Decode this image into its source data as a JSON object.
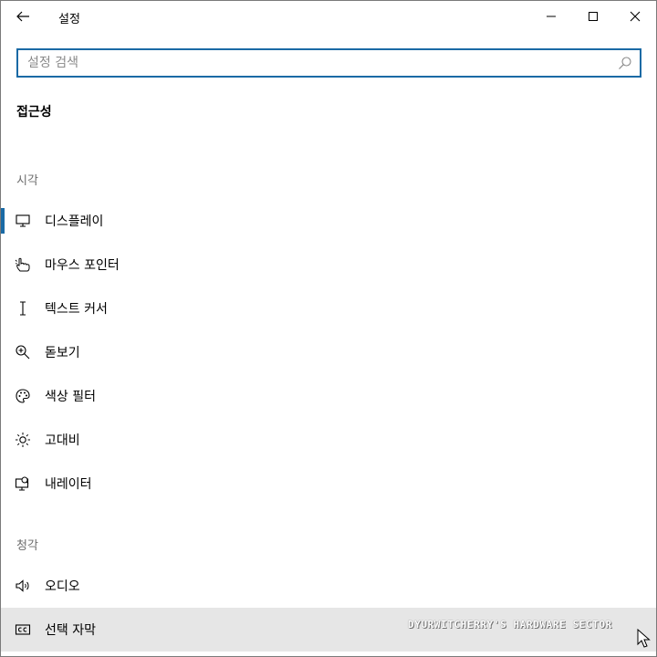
{
  "window": {
    "title": "설정"
  },
  "search": {
    "placeholder": "설정 검색",
    "value": ""
  },
  "page": {
    "title": "접근성"
  },
  "groups": {
    "vision": "시각",
    "hearing": "청각"
  },
  "items": [
    {
      "label": "디스플레이",
      "icon": "monitor-icon",
      "selected": true
    },
    {
      "label": "마우스 포인터",
      "icon": "mouse-pointer-icon"
    },
    {
      "label": "텍스트 커서",
      "icon": "text-cursor-icon"
    },
    {
      "label": "돋보기",
      "icon": "magnifier-icon"
    },
    {
      "label": "색상 필터",
      "icon": "palette-icon"
    },
    {
      "label": "고대비",
      "icon": "brightness-icon"
    },
    {
      "label": "내레이터",
      "icon": "narrator-icon"
    },
    {
      "label": "오디오",
      "icon": "speaker-icon"
    },
    {
      "label": "선택 자막",
      "icon": "closed-caption-icon"
    }
  ],
  "watermark": "DYURWITCHERRY'S HARDWARE SECTOR",
  "colors": {
    "accent": "#1a6aa5",
    "hover_background": "#e6e6e6",
    "group_label": "#6b6b6b"
  }
}
